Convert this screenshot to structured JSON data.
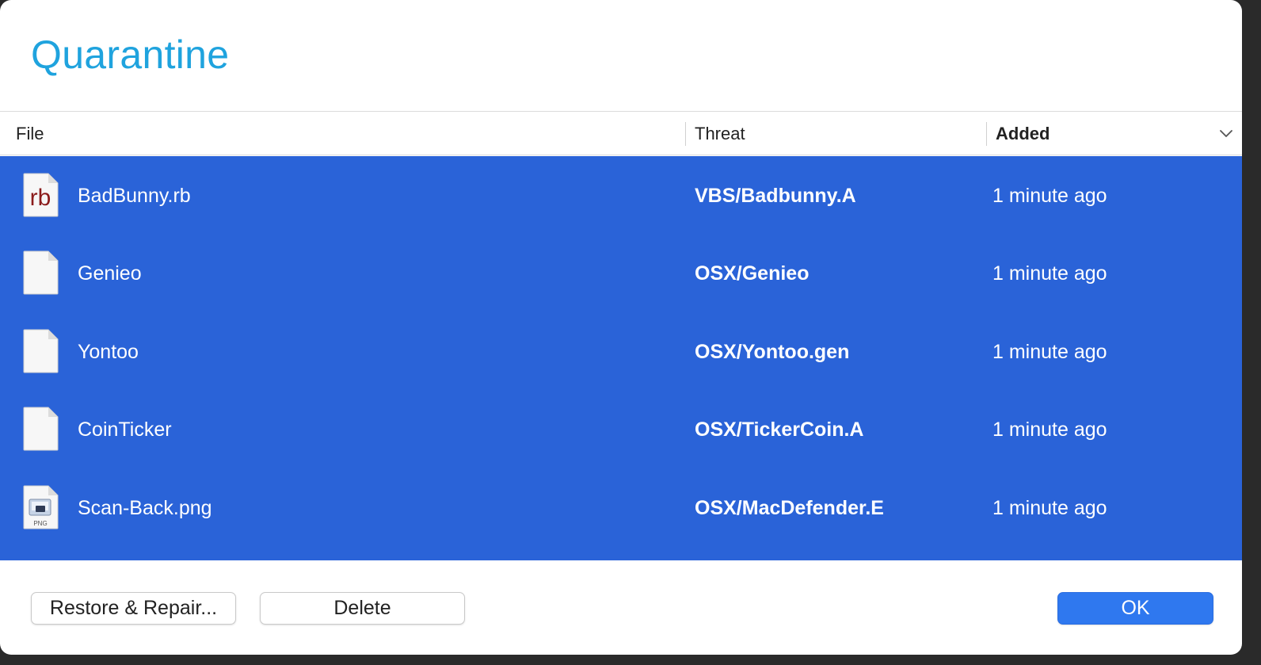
{
  "dialog": {
    "title": "Quarantine"
  },
  "table": {
    "columns": {
      "file": "File",
      "threat": "Threat",
      "added": "Added"
    },
    "sorted_column": "Added",
    "sort_direction": "descending",
    "rows": [
      {
        "file": "BadBunny.rb",
        "threat": "VBS/Badbunny.A",
        "added": "1 minute ago",
        "icon": "ruby-file-icon",
        "icon_text": "rb"
      },
      {
        "file": "Genieo",
        "threat": "OSX/Genieo",
        "added": "1 minute ago",
        "icon": "generic-file-icon"
      },
      {
        "file": "Yontoo",
        "threat": "OSX/Yontoo.gen",
        "added": "1 minute ago",
        "icon": "generic-file-icon"
      },
      {
        "file": "CoinTicker",
        "threat": "OSX/TickerCoin.A",
        "added": "1 minute ago",
        "icon": "generic-file-icon"
      },
      {
        "file": "Scan-Back.png",
        "threat": "OSX/MacDefender.E",
        "added": "1 minute ago",
        "icon": "png-file-icon",
        "icon_text": "PNG"
      }
    ],
    "selection_color": "#2a63d8"
  },
  "buttons": {
    "restore": "Restore & Repair...",
    "delete": "Delete",
    "ok": "OK"
  },
  "colors": {
    "title": "#1fa3de",
    "primary_button": "#2f78ef"
  }
}
